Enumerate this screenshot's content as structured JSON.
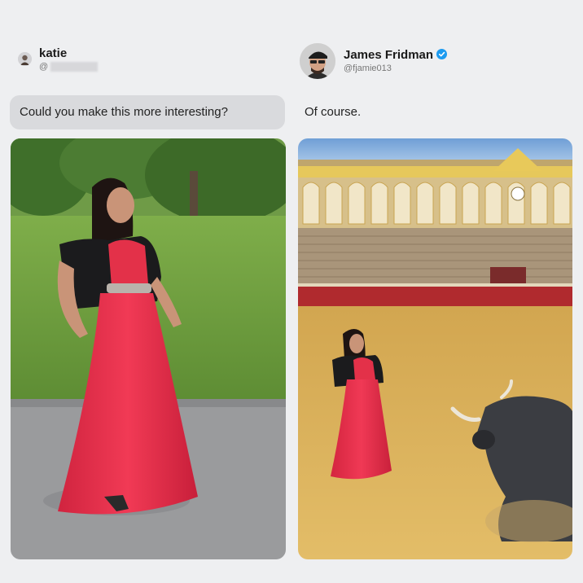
{
  "left_post": {
    "username": "katie",
    "handle": "@",
    "message": "Could you make this more interesting?"
  },
  "right_post": {
    "username": "James Fridman",
    "handle": "@fjamie013",
    "reply": "Of course.",
    "verified_badge": "verified-check-icon"
  },
  "colors": {
    "background": "#eeeff1",
    "bubble": "#d9dadd",
    "dress": "#e8304a",
    "verified": "#1d9bf0",
    "arena_sand": "#d8b05a"
  }
}
